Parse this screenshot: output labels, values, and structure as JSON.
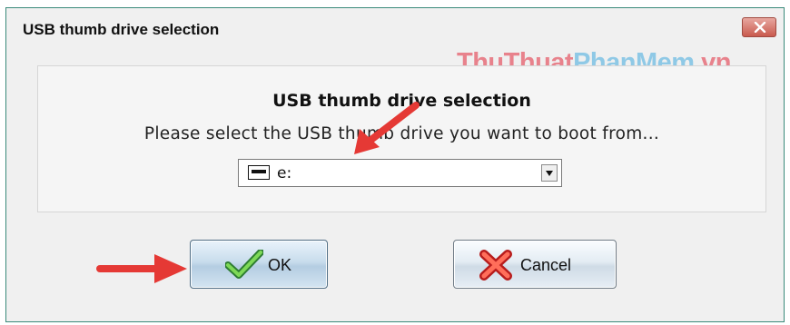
{
  "window": {
    "title": "USB thumb drive selection",
    "close_icon": "close-icon"
  },
  "watermark": {
    "part1": "ThuThuat",
    "part2": "PhanMem",
    "part3": ".vn"
  },
  "dialog": {
    "heading": "USB thumb drive selection",
    "message": "Please select the USB thumb drive you want to boot from...",
    "drive_select": {
      "selected": "e:",
      "icon": "usb-drive-icon"
    }
  },
  "buttons": {
    "ok_label": "OK",
    "ok_icon": "checkmark-icon",
    "cancel_label": "Cancel",
    "cancel_icon": "x-mark-icon"
  },
  "colors": {
    "annotation_arrow": "#e53935",
    "watermark_pink": "#e8828c",
    "watermark_blue": "#8fc9e6",
    "close_button": "#c95a4e"
  }
}
